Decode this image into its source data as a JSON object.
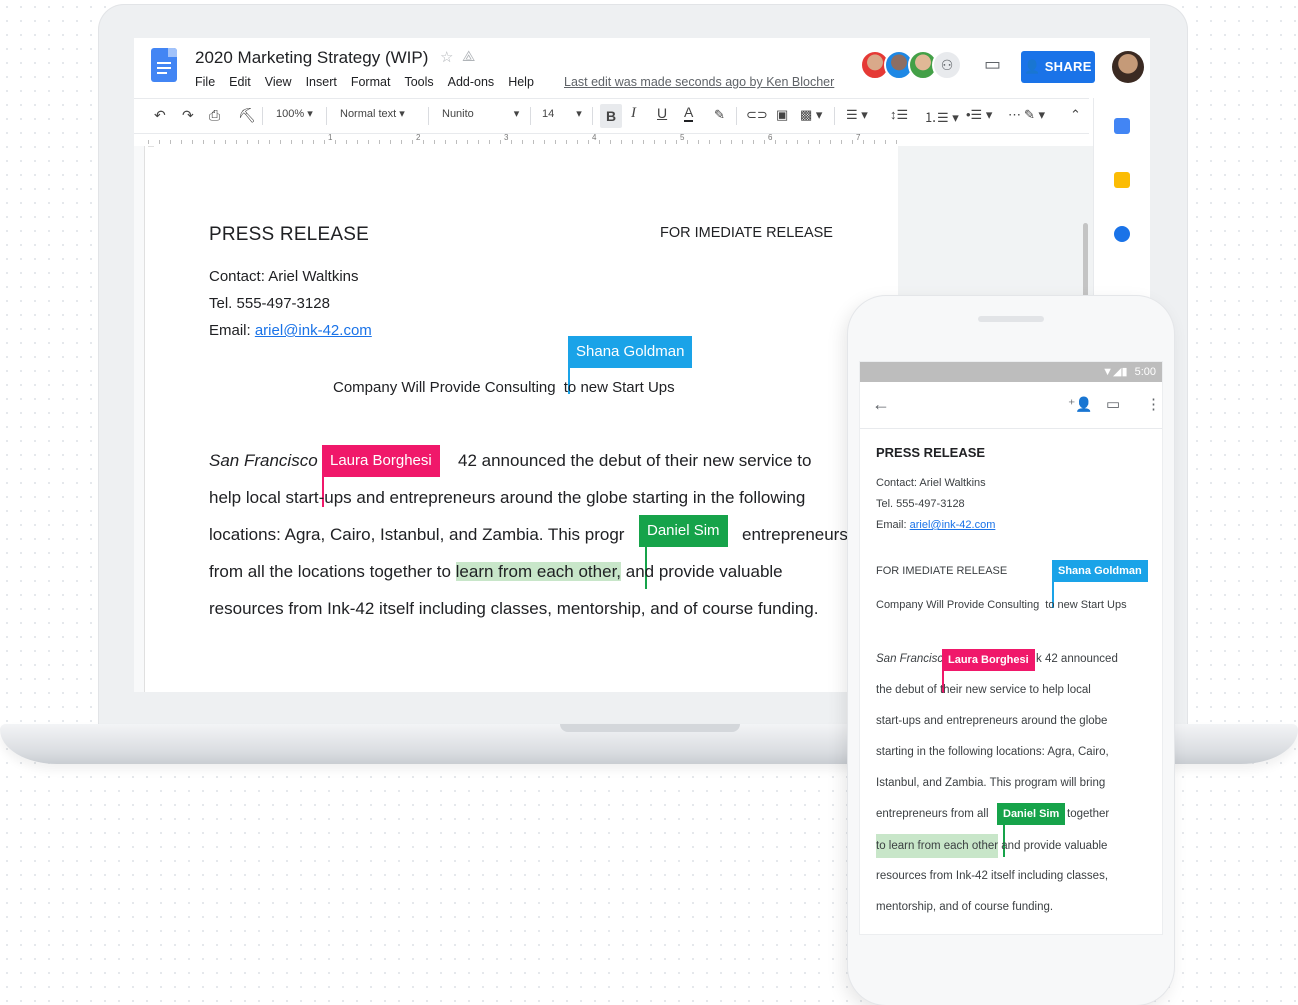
{
  "doc": {
    "title": "2020 Marketing Strategy (WIP)",
    "menu": [
      "File",
      "Edit",
      "View",
      "Insert",
      "Format",
      "Tools",
      "Add-ons",
      "Help"
    ],
    "last_edit": "Last edit was made seconds ago by Ken Blocher",
    "share_label": "SHARE",
    "toolbar": {
      "zoom": "100%",
      "style": "Normal text",
      "font": "Nunito",
      "size": "14",
      "bold": "B",
      "italic": "I",
      "underline": "U",
      "text_color": "A"
    },
    "ruler_numbers": [
      "1",
      "2",
      "3",
      "4",
      "5",
      "6",
      "7"
    ]
  },
  "page": {
    "press_release": "PRESS RELEASE",
    "for_release": "FOR IMEDIATE RELEASE",
    "contact": "Contact: Ariel Waltkins",
    "tel": "Tel. 555-497-3128",
    "email_label": "Email: ",
    "email": "ariel@ink-42.com",
    "subtitle_a": "Company Will Provide Consulting",
    "subtitle_b": " to new Start Ups",
    "line1_city": "San Francisco",
    "line1_rest": "42 announced the debut of their new service to",
    "line2": "help local start-ups and entrepreneurs around the globe starting in the following",
    "line3_a": "locations: Agra, Cairo, Istanbul, and Zambia. This progr",
    "line3_b": "entrepreneurs",
    "line4_a": "from all the locations together to ",
    "line4_hl": "learn from each other,",
    "line4_b": " and provide valuable",
    "line5": "resources from Ink-42 itself including classes, mentorship, and of course funding."
  },
  "collaborators": {
    "shana": "Shana Goldman",
    "laura": "Laura Borghesi",
    "daniel": "Daniel Sim"
  },
  "colors": {
    "shana": "#1aa3e8",
    "laura": "#f0186a",
    "daniel": "#16a34a",
    "accent": "#1a73e8"
  },
  "phone": {
    "status_time": "5:00",
    "press_release": "PRESS RELEASE",
    "contact": "Contact: Ariel Waltkins",
    "tel": "Tel. 555-497-3128",
    "email_label": "Email: ",
    "email": "ariel@ink-42.com",
    "for_release": "FOR IMEDIATE RELEASE",
    "subtitle_a": "Company Will Provide Consulting",
    "subtitle_b": " to new Start Ups",
    "p1_a": "San Francisc",
    "p1_b": "k 42 announced",
    "p2": "the debut of their new service to help local",
    "p3": "start-ups and entrepreneurs around the globe",
    "p4": "starting in the following locations: Agra, Cairo,",
    "p5": "Istanbul, and Zambia. This program will bring",
    "p6_a": "entrepreneurs from all",
    "p6_b": "together",
    "p7_hl": "to learn from each other",
    "p7_b": " and provide valuable",
    "p8": "resources from Ink-42 itself including classes,",
    "p9": "mentorship, and of course funding."
  }
}
